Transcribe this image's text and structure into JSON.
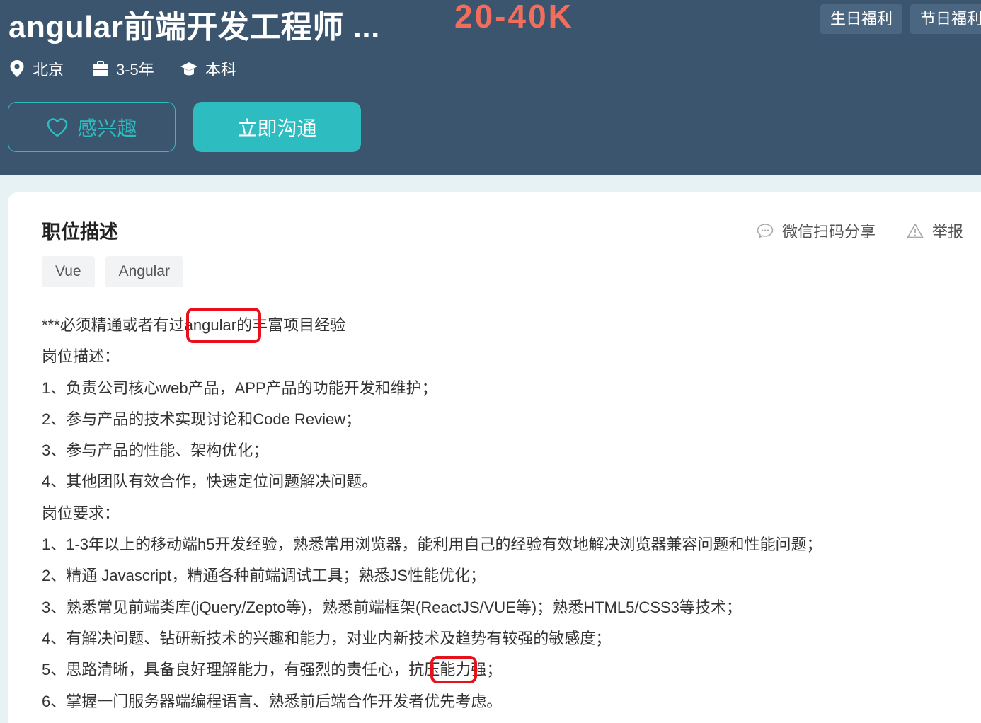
{
  "job": {
    "title": "angular前端开发工程师 ...",
    "salary": "20-40K",
    "welfare": [
      "生日福利",
      "节日福利"
    ],
    "location": "北京",
    "experience": "3-5年",
    "education": "本科"
  },
  "actions": {
    "interest_label": "感兴趣",
    "chat_label": "立即沟通"
  },
  "section": {
    "title": "职位描述",
    "share_label": "微信扫码分享",
    "report_label": "举报",
    "tags": [
      "Vue",
      "Angular"
    ]
  },
  "description": {
    "lines": [
      "***必须精通或者有过angular的丰富项目经验",
      "岗位描述：",
      "1、负责公司核心web产品，APP产品的功能开发和维护；",
      "2、参与产品的技术实现讨论和Code Review；",
      "3、参与产品的性能、架构优化；",
      "4、其他团队有效合作，快速定位问题解决问题。",
      "岗位要求：",
      "1、1-3年以上的移动端h5开发经验，熟悉常用浏览器，能利用自己的经验有效地解决浏览器兼容问题和性能问题；",
      "2、精通 Javascript，精通各种前端调试工具；熟悉JS性能优化；",
      "3、熟悉常见前端类库(jQuery/Zepto等)，熟悉前端框架(ReactJS/VUE等)；熟悉HTML5/CSS3等技术；",
      "4、有解决问题、钻研新技术的兴趣和能力，对业内新技术及趋势有较强的敏感度；",
      "5、思路清晰，具备良好理解能力，有强烈的责任心，抗压能力强；",
      "6、掌握一门服务器端编程语言、熟悉前后端合作开发者优先考虑。"
    ]
  },
  "colors": {
    "header_bg": "#3a556d",
    "accent": "#2dbdc0",
    "salary": "#f26d5b",
    "highlight": "#e8101a"
  }
}
